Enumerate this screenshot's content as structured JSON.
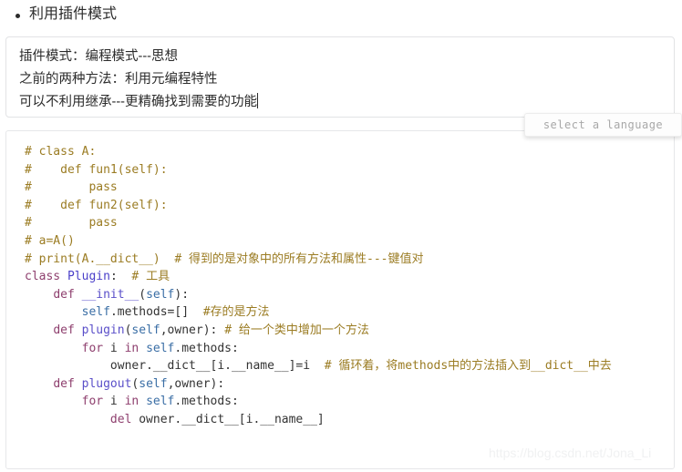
{
  "heading": {
    "bullet_text": "利用插件模式"
  },
  "note_editor": {
    "lines": [
      "插件模式：编程模式---思想",
      "之前的两种方法：利用元编程特性",
      "可以不利用继承---更精确找到需要的功能"
    ],
    "caret_visible": true
  },
  "language_selector": {
    "placeholder": "select a language"
  },
  "code_block": {
    "language": "python",
    "colors": {
      "comment": "#9b7c23",
      "keyword": "#8e3f6e",
      "class_name": "#4a3fc9",
      "function_name": "#5a4fc9",
      "self": "#3a6ea5",
      "plain": "#333333"
    },
    "lines": [
      {
        "tokens": [
          {
            "t": "# class A:",
            "c": "com"
          }
        ]
      },
      {
        "tokens": [
          {
            "t": "#    def fun1(self):",
            "c": "com"
          }
        ]
      },
      {
        "tokens": [
          {
            "t": "#        pass",
            "c": "com"
          }
        ]
      },
      {
        "tokens": [
          {
            "t": "#    def fun2(self):",
            "c": "com"
          }
        ]
      },
      {
        "tokens": [
          {
            "t": "#        pass",
            "c": "com"
          }
        ]
      },
      {
        "tokens": [
          {
            "t": "# a=A()",
            "c": "com"
          }
        ]
      },
      {
        "tokens": [
          {
            "t": "# print(A.__dict__)  # 得到的是对象中的所有方法和属性---键值对",
            "c": "com"
          }
        ]
      },
      {
        "tokens": [
          {
            "t": "class",
            "c": "kw"
          },
          {
            "t": " ",
            "c": "def"
          },
          {
            "t": "Plugin",
            "c": "cls"
          },
          {
            "t": ":  ",
            "c": "def"
          },
          {
            "t": "# 工具",
            "c": "com"
          }
        ]
      },
      {
        "tokens": [
          {
            "t": "    ",
            "c": "def"
          },
          {
            "t": "def",
            "c": "kw"
          },
          {
            "t": " ",
            "c": "def"
          },
          {
            "t": "__init__",
            "c": "fn"
          },
          {
            "t": "(",
            "c": "def"
          },
          {
            "t": "self",
            "c": "self"
          },
          {
            "t": "):",
            "c": "def"
          }
        ]
      },
      {
        "tokens": [
          {
            "t": "        ",
            "c": "def"
          },
          {
            "t": "self",
            "c": "self"
          },
          {
            "t": ".methods=[]  ",
            "c": "def"
          },
          {
            "t": "#存的是方法",
            "c": "com"
          }
        ]
      },
      {
        "tokens": [
          {
            "t": "    ",
            "c": "def"
          },
          {
            "t": "def",
            "c": "kw"
          },
          {
            "t": " ",
            "c": "def"
          },
          {
            "t": "plugin",
            "c": "fn"
          },
          {
            "t": "(",
            "c": "def"
          },
          {
            "t": "self",
            "c": "self"
          },
          {
            "t": ",owner): ",
            "c": "def"
          },
          {
            "t": "# 给一个类中增加一个方法",
            "c": "com"
          }
        ]
      },
      {
        "tokens": [
          {
            "t": "        ",
            "c": "def"
          },
          {
            "t": "for",
            "c": "kw"
          },
          {
            "t": " i ",
            "c": "def"
          },
          {
            "t": "in",
            "c": "kw"
          },
          {
            "t": " ",
            "c": "def"
          },
          {
            "t": "self",
            "c": "self"
          },
          {
            "t": ".methods:",
            "c": "def"
          }
        ]
      },
      {
        "tokens": [
          {
            "t": "            owner.__dict__[i.__name__]=i  ",
            "c": "def"
          },
          {
            "t": "# 循环着，将methods中的方法插入到__dict__中去",
            "c": "com"
          }
        ]
      },
      {
        "tokens": [
          {
            "t": "    ",
            "c": "def"
          },
          {
            "t": "def",
            "c": "kw"
          },
          {
            "t": " ",
            "c": "def"
          },
          {
            "t": "plugout",
            "c": "fn"
          },
          {
            "t": "(",
            "c": "def"
          },
          {
            "t": "self",
            "c": "self"
          },
          {
            "t": ",owner):",
            "c": "def"
          }
        ]
      },
      {
        "tokens": [
          {
            "t": "        ",
            "c": "def"
          },
          {
            "t": "for",
            "c": "kw"
          },
          {
            "t": " i ",
            "c": "def"
          },
          {
            "t": "in",
            "c": "kw"
          },
          {
            "t": " ",
            "c": "def"
          },
          {
            "t": "self",
            "c": "self"
          },
          {
            "t": ".methods:",
            "c": "def"
          }
        ]
      },
      {
        "tokens": [
          {
            "t": "            ",
            "c": "def"
          },
          {
            "t": "del",
            "c": "kw"
          },
          {
            "t": " owner.__dict__[i.__name__]",
            "c": "def"
          }
        ]
      }
    ]
  },
  "watermark": {
    "text": "https://blog.csdn.net/Jona_Li"
  }
}
